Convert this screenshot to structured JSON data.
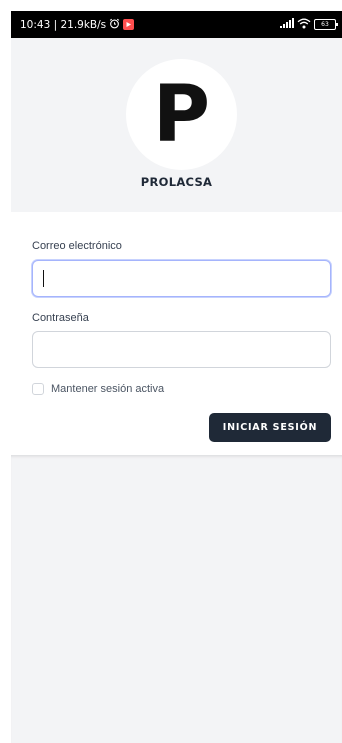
{
  "status_bar": {
    "time_speed": "10:43 | 21.9kB/s",
    "battery_level": "63",
    "icons": [
      "alarm-icon",
      "play-store-icon",
      "signal-icon",
      "wifi-icon",
      "battery-icon"
    ]
  },
  "header": {
    "logo_letter": "P",
    "brand_name": "PROLACSA"
  },
  "form": {
    "email_label": "Correo electrónico",
    "email_value": "",
    "password_label": "Contraseña",
    "password_value": "",
    "remember_label": "Mantener sesión activa",
    "remember_checked": false,
    "submit_label": "INICIAR SESIÓN"
  },
  "colors": {
    "button_bg": "#1f2937",
    "panel_bg": "#f3f4f6",
    "focus_ring": "#a5b4fc"
  }
}
